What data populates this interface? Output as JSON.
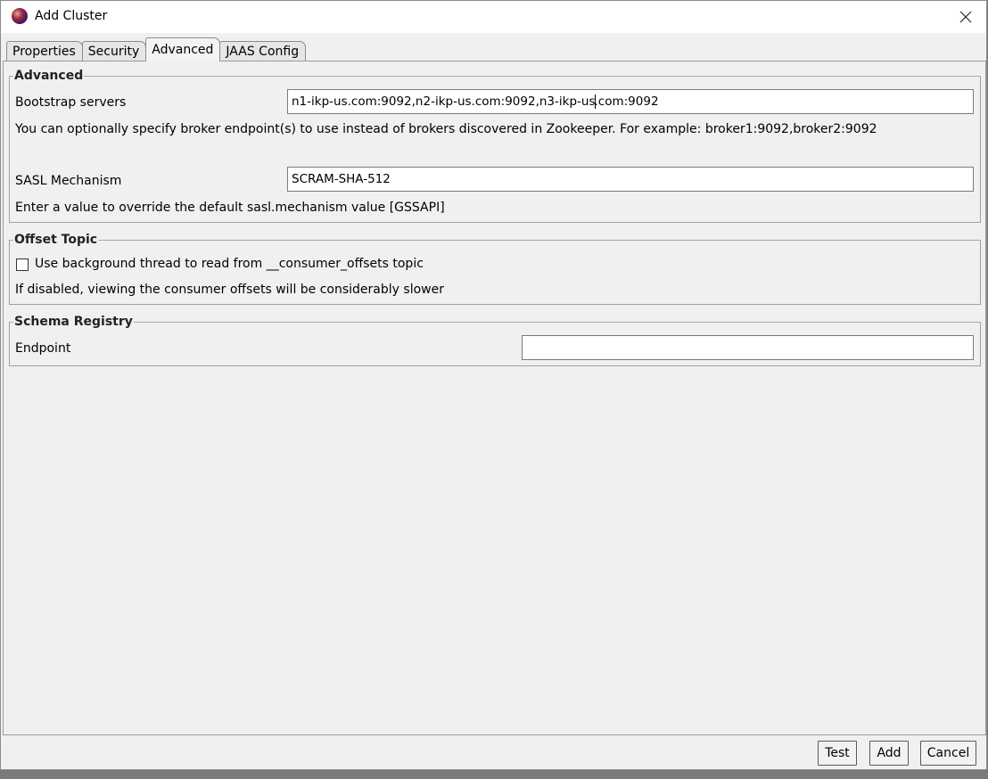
{
  "window": {
    "title": "Add Cluster",
    "app_icon": "app-logo-icon",
    "close_icon": "close-icon"
  },
  "tabs": [
    {
      "label": "Properties",
      "active": false
    },
    {
      "label": "Security",
      "active": false
    },
    {
      "label": "Advanced",
      "active": true
    },
    {
      "label": "JAAS Config",
      "active": false
    }
  ],
  "advanced": {
    "legend": "Advanced",
    "bootstrap_label": "Bootstrap servers",
    "bootstrap_value_before_caret": "n1-ikp-us.com:9092,n2-ikp-us.com:9092,n3-ikp-us",
    "bootstrap_value_after_caret": ".com:9092",
    "bootstrap_help": "You can optionally specify broker endpoint(s) to use instead of brokers discovered in Zookeeper. For example: broker1:9092,broker2:9092",
    "sasl_label": "SASL Mechanism",
    "sasl_value": "SCRAM-SHA-512",
    "sasl_help": "Enter a value to override the default sasl.mechanism value [GSSAPI]"
  },
  "offset_topic": {
    "legend": "Offset Topic",
    "checkbox_label": "Use background thread to read from __consumer_offsets topic",
    "checked": false,
    "help": "If disabled, viewing the consumer offsets will be considerably slower"
  },
  "schema_registry": {
    "legend": "Schema Registry",
    "endpoint_label": "Endpoint",
    "endpoint_value": ""
  },
  "buttons": {
    "test": "Test",
    "add": "Add",
    "cancel": "Cancel"
  }
}
